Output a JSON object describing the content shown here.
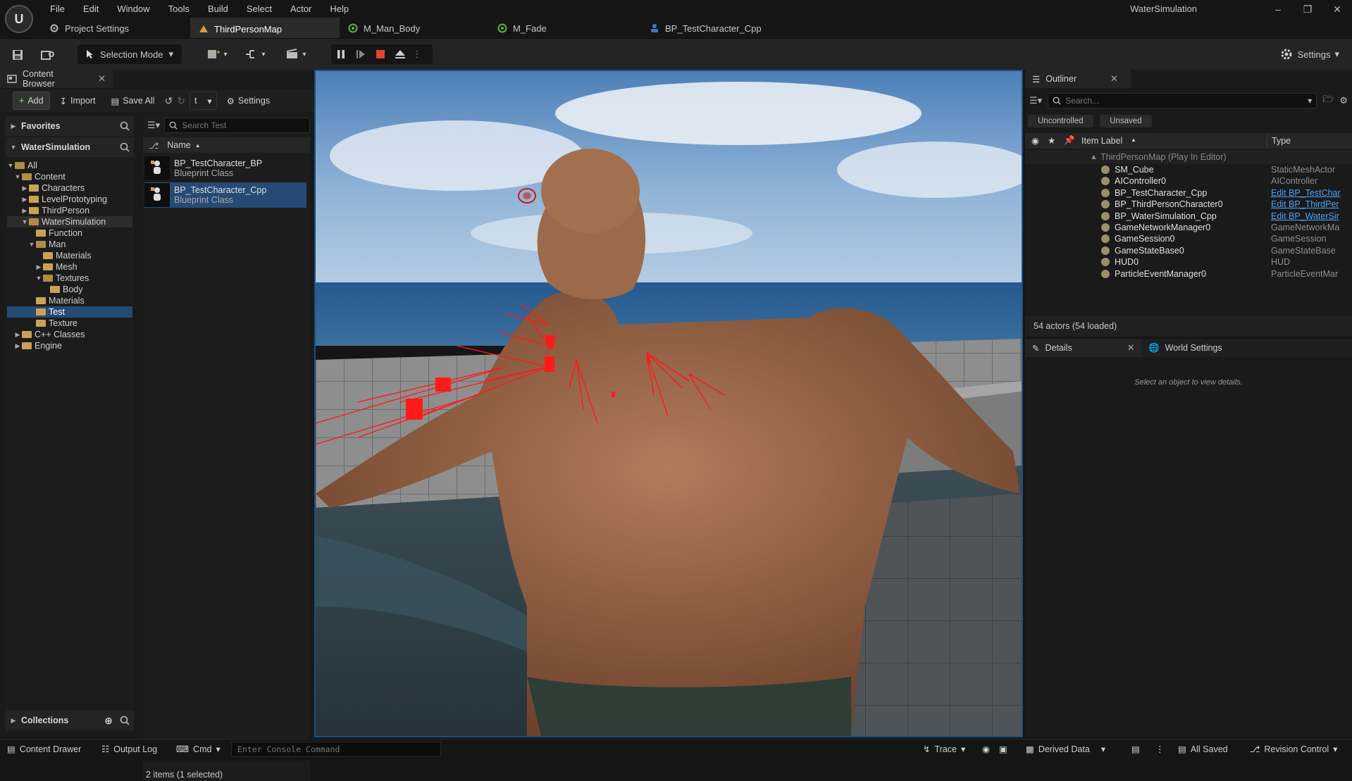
{
  "app": {
    "title": "WaterSimulation",
    "logo": "unreal-logo-icon"
  },
  "menu": [
    "File",
    "Edit",
    "Window",
    "Tools",
    "Build",
    "Select",
    "Actor",
    "Help"
  ],
  "tabs": [
    {
      "label": "Project Settings",
      "icon": "gear-icon"
    },
    {
      "label": "ThirdPersonMap",
      "icon": "level-icon",
      "active": true
    },
    {
      "label": "M_Man_Body",
      "icon": "material-icon"
    },
    {
      "label": "M_Fade",
      "icon": "material-icon"
    },
    {
      "label": "BP_TestCharacter_Cpp",
      "icon": "blueprint-icon"
    }
  ],
  "toolbar": {
    "selection_mode": "Selection Mode",
    "settings": "Settings"
  },
  "content_browser": {
    "tab": "Content Browser",
    "add": "Add",
    "import": "Import",
    "save_all": "Save All",
    "path_crumb": "t",
    "settings": "Settings",
    "favorites": "Favorites",
    "project": "WaterSimulation",
    "tree": [
      {
        "label": "All",
        "depth": 0,
        "caret": "▼"
      },
      {
        "label": "Content",
        "depth": 1,
        "caret": "▼"
      },
      {
        "label": "Characters",
        "depth": 2,
        "caret": "▶"
      },
      {
        "label": "LevelPrototyping",
        "depth": 2,
        "caret": "▶"
      },
      {
        "label": "ThirdPerson",
        "depth": 2,
        "caret": "▶"
      },
      {
        "label": "WaterSimulation",
        "depth": 2,
        "caret": "▼",
        "highlight": true
      },
      {
        "label": "Function",
        "depth": 3,
        "caret": ""
      },
      {
        "label": "Man",
        "depth": 3,
        "caret": "▼"
      },
      {
        "label": "Materials",
        "depth": 4,
        "caret": ""
      },
      {
        "label": "Mesh",
        "depth": 4,
        "caret": "▶"
      },
      {
        "label": "Textures",
        "depth": 4,
        "caret": "▼"
      },
      {
        "label": "Body",
        "depth": 5,
        "caret": ""
      },
      {
        "label": "Materials",
        "depth": 3,
        "caret": ""
      },
      {
        "label": "Test",
        "depth": 3,
        "caret": "",
        "selected": true
      },
      {
        "label": "Texture",
        "depth": 3,
        "caret": ""
      },
      {
        "label": "C++ Classes",
        "depth": 1,
        "caret": "▶"
      },
      {
        "label": "Engine",
        "depth": 1,
        "caret": "▶"
      }
    ],
    "search_placeholder": "Search Test",
    "column_name": "Name",
    "assets": [
      {
        "name": "BP_TestCharacter_BP",
        "type": "Blueprint Class",
        "selected": false
      },
      {
        "name": "BP_TestCharacter_Cpp",
        "type": "Blueprint Class",
        "selected": true
      }
    ],
    "item_count": "2 items (1 selected)",
    "collections": "Collections"
  },
  "outliner": {
    "tab": "Outliner",
    "search_placeholder": "Search...",
    "filters": [
      "Uncontrolled",
      "Unsaved"
    ],
    "col_label": "Item Label",
    "col_type": "Type",
    "root": "ThirdPersonMap (Play In Editor)",
    "rows": [
      {
        "label": "SM_Cube",
        "type": "StaticMeshActor",
        "link": false
      },
      {
        "label": "AIController0",
        "type": "AIController",
        "link": false
      },
      {
        "label": "BP_TestCharacter_Cpp",
        "type": "Edit BP_TestChar",
        "link": true
      },
      {
        "label": "BP_ThirdPersonCharacter0",
        "type": "Edit BP_ThirdPer",
        "link": true
      },
      {
        "label": "BP_WaterSimulation_Cpp",
        "type": "Edit BP_WaterSir",
        "link": true
      },
      {
        "label": "GameNetworkManager0",
        "type": "GameNetworkMa",
        "link": false
      },
      {
        "label": "GameSession0",
        "type": "GameSession",
        "link": false
      },
      {
        "label": "GameStateBase0",
        "type": "GameStateBase",
        "link": false
      },
      {
        "label": "HUD0",
        "type": "HUD",
        "link": false
      },
      {
        "label": "ParticleEventManager0",
        "type": "ParticleEventMar",
        "link": false
      }
    ],
    "actor_count": "54 actors (54 loaded)"
  },
  "details": {
    "tab": "Details",
    "world_tab": "World Settings",
    "empty_message": "Select an object to view details."
  },
  "statusbar": {
    "content_drawer": "Content Drawer",
    "output_log": "Output Log",
    "cmd": "Cmd",
    "console_placeholder": "Enter Console Command",
    "trace": "Trace",
    "derived_data": "Derived Data",
    "all_saved": "All Saved",
    "revision_control": "Revision Control"
  },
  "colors": {
    "accent_selection": "#254a75",
    "link": "#4ea3f5",
    "stop": "#e0452d",
    "viewport_border": "#1b4f82"
  }
}
